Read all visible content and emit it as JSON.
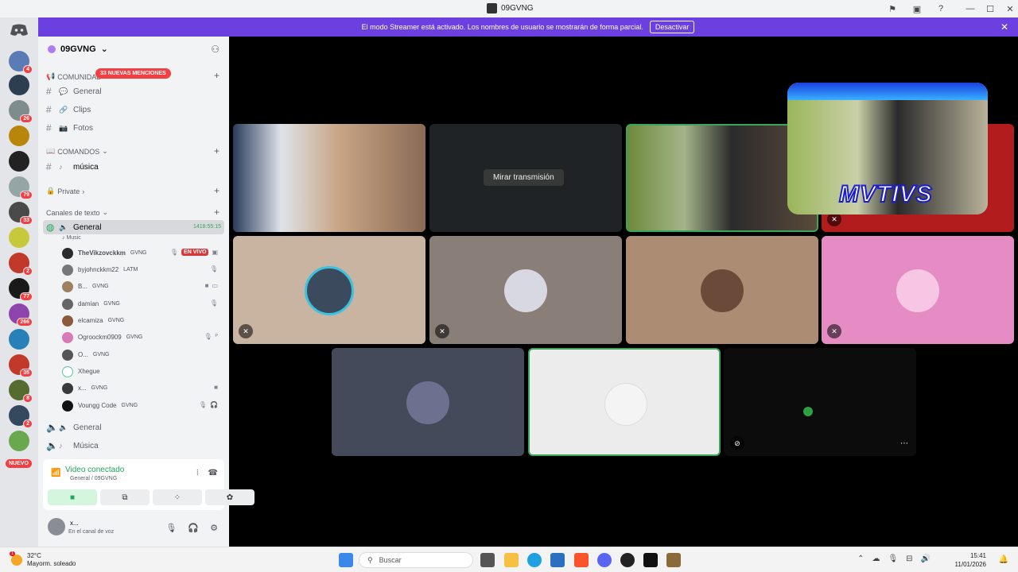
{
  "titlebar": {
    "title": "09GVNG"
  },
  "banner": {
    "message": "El modo Streamer está activado. Los nombres de usuario se mostrarán de forma parcial.",
    "button": "Desactivar"
  },
  "rail": {
    "badges": [
      "4",
      "26",
      "79",
      "33",
      "2",
      "77",
      "266",
      "35",
      "8",
      "2"
    ],
    "new_label": "NUEVO"
  },
  "server": {
    "name": "09GVNG",
    "mentions": "33 NUEVAS MENCIONES",
    "categories": {
      "comunidad": "COMUNIDAD",
      "comandos": "COMANDOS",
      "private": "Private",
      "texto": "Canales de texto"
    },
    "channels": {
      "general": "General",
      "clips": "Clips",
      "fotos": "Fotos",
      "musica": "música",
      "voice_general": "General",
      "voice_time": "1418:55:15",
      "voice_sub": "Music",
      "general1": "General",
      "musica2": "Música"
    },
    "users": [
      {
        "name": "TheVikzovckkm",
        "tag": "GVNG",
        "live": "EN VIVO"
      },
      {
        "name": "byjohnckkm22",
        "tag": "LATM"
      },
      {
        "name": "B...",
        "tag": "GVNG"
      },
      {
        "name": "damian",
        "tag": "GVNG"
      },
      {
        "name": "elcamiza",
        "tag": "GVNG"
      },
      {
        "name": "Ogroockm0909",
        "tag": "GVNG"
      },
      {
        "name": "O...",
        "tag": "GVNG"
      },
      {
        "name": "Xhegue",
        "tag": ""
      },
      {
        "name": "x...",
        "tag": "GVNG"
      },
      {
        "name": "Voungg Code",
        "tag": "GVNG"
      }
    ]
  },
  "voice": {
    "status": "Video conectado",
    "channel": "General / 09GVNG"
  },
  "user": {
    "name": "x...",
    "status": "En el canal de voz"
  },
  "video": {
    "watch_label": "Mirar transmisión",
    "stream_text": "MVTIVS"
  },
  "taskbar": {
    "temp": "32°C",
    "weather": "Mayorm. soleado",
    "weather_badge": "1",
    "search": "Buscar",
    "time": "15:41",
    "date": "11/01/2026"
  },
  "colors": {
    "blurple": "#6b3fe0",
    "green": "#23a559",
    "red": "#f23f43"
  }
}
